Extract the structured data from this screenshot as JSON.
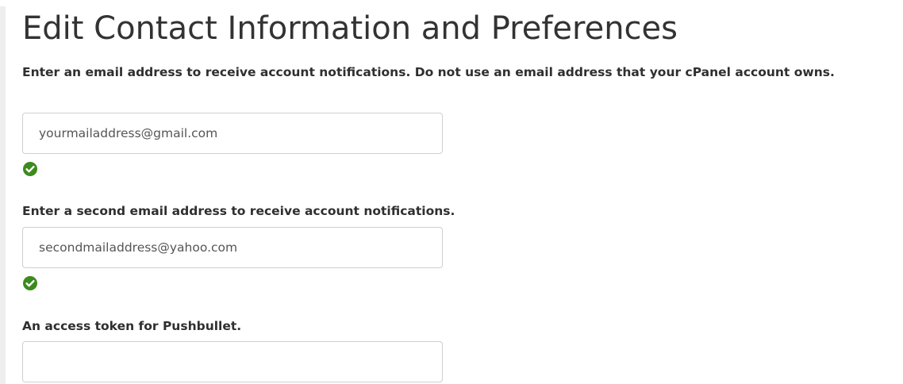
{
  "page": {
    "title": "Edit Contact Information and Preferences"
  },
  "form": {
    "email_primary": {
      "label": "Enter an email address to receive account notifications. Do not use an email address that your cPanel account owns.",
      "value": "yourmailaddress@gmail.com",
      "status_icon": "valid-check-icon"
    },
    "email_secondary": {
      "label": "Enter a second email address to receive account notifications.",
      "value": "secondmailaddress@yahoo.com",
      "status_icon": "valid-check-icon"
    },
    "pushbullet": {
      "label": "An access token for Pushbullet.",
      "value": ""
    }
  },
  "colors": {
    "valid": "#3c8b1e",
    "text": "#333333",
    "border": "#cfcfcf"
  }
}
